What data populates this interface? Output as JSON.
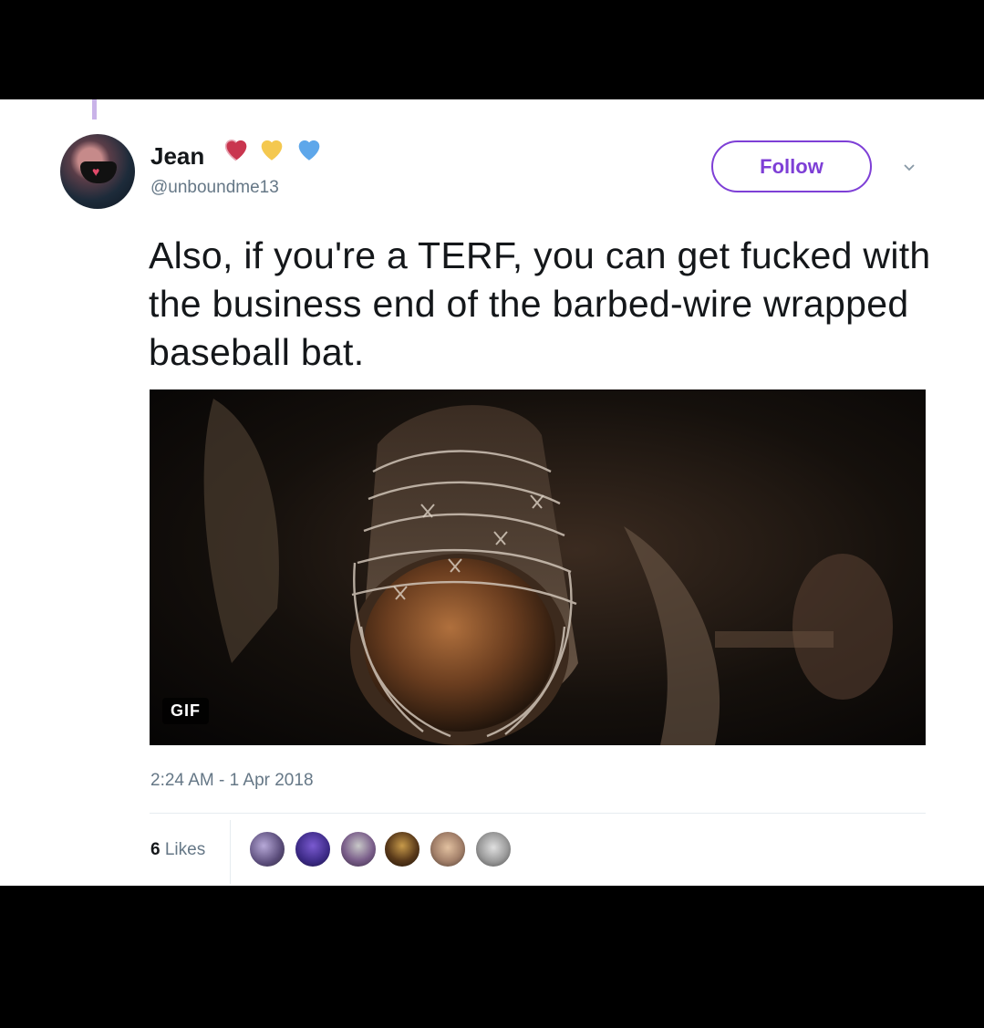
{
  "tweet": {
    "author": {
      "name": "Jean",
      "handle": "@unboundme13",
      "emoji_icons": [
        "red-heart-icon",
        "yellow-heart-icon",
        "blue-heart-icon"
      ]
    },
    "follow_label": "Follow",
    "text": "Also, if you're a TERF, you can get fucked with the business end of the barbed-wire wrapped baseball bat.",
    "media": {
      "badge": "GIF"
    },
    "timestamp": "2:24 AM - 1 Apr 2018",
    "likes": {
      "count": "6",
      "label": "Likes"
    }
  },
  "colors": {
    "accent": "#7e3fd6",
    "secondary_text": "#657786",
    "primary_text": "#14171a",
    "thread_line": "#c9b3e8"
  }
}
